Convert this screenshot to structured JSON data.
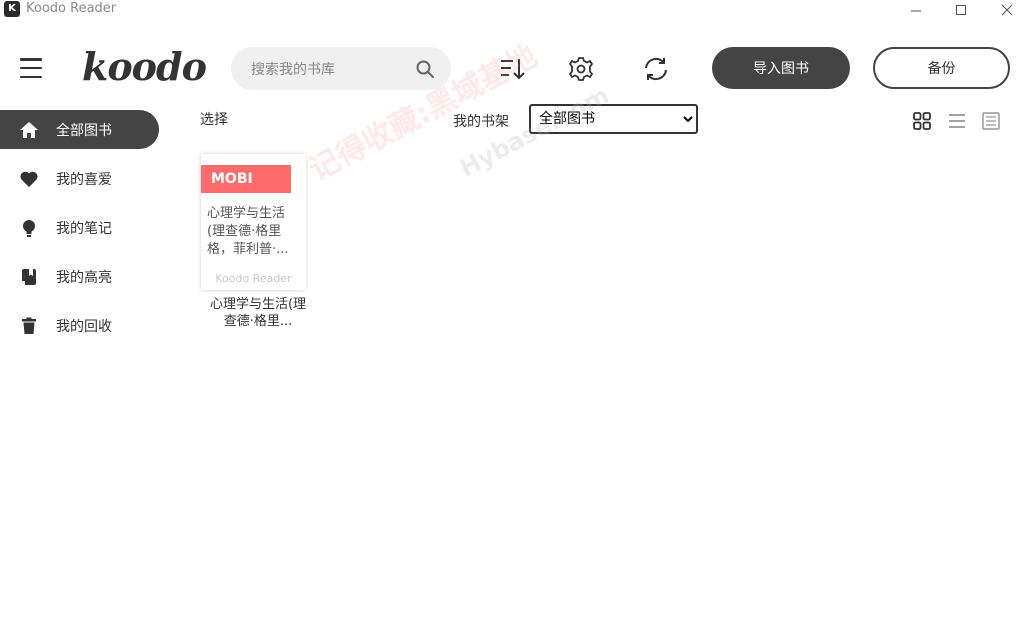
{
  "window": {
    "title": "Koodo Reader",
    "app_icon_letter": "K"
  },
  "header": {
    "logo": "koodo",
    "search_placeholder": "搜索我的书库",
    "import_label": "导入图书",
    "backup_label": "备份"
  },
  "sidebar": {
    "items": [
      {
        "label": "全部图书",
        "icon": "home-icon",
        "active": true
      },
      {
        "label": "我的喜爱",
        "icon": "heart-icon",
        "active": false
      },
      {
        "label": "我的笔记",
        "icon": "lightbulb-icon",
        "active": false
      },
      {
        "label": "我的高亮",
        "icon": "bookmark-book-icon",
        "active": false
      },
      {
        "label": "我的回收",
        "icon": "trash-icon",
        "active": false
      }
    ]
  },
  "toolbar": {
    "select_label": "选择",
    "shelf_label": "我的书架",
    "shelf_selected": "全部图书"
  },
  "books": [
    {
      "format": "MOBI",
      "card_title": "心理学与生活(理查德·格里格，菲利普·...",
      "card_brand": "Koodo Reader",
      "name": "心理学与生活(理查德·格里..."
    }
  ],
  "watermark": {
    "text": "记得收藏:黑域基地",
    "url_text": "Hybase.com"
  },
  "colors": {
    "accent_dark": "#444444",
    "badge": "#ff6b6b"
  }
}
